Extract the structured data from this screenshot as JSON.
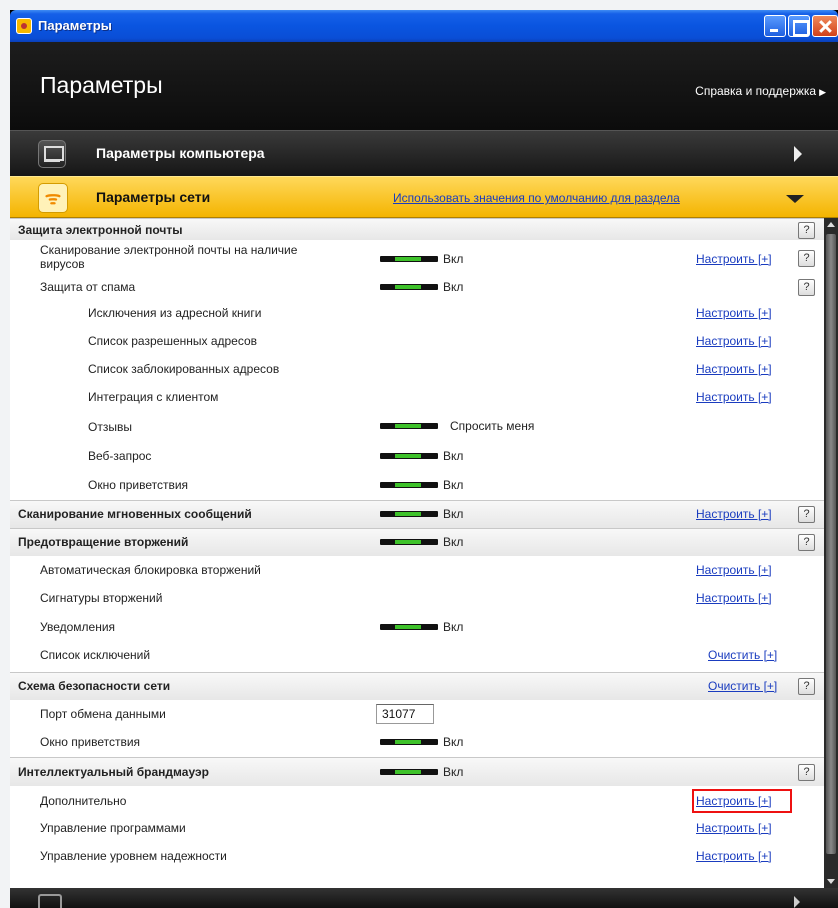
{
  "window": {
    "title": "Параметры"
  },
  "header": {
    "title": "Параметры",
    "help_link": "Справка и поддержка"
  },
  "bars": {
    "computer": {
      "label": "Параметры компьютера"
    },
    "network": {
      "label": "Параметры сети",
      "defaults_link": "Использовать значения по умолчанию для раздела"
    }
  },
  "rows": [
    {
      "label": "Защита электронной почты",
      "help": "?"
    },
    {
      "label": "Сканирование электронной почты на наличие вирусов",
      "status": "Вкл",
      "action": "Настроить [+]",
      "help": "?"
    },
    {
      "label": "Защита от спама",
      "status": "Вкл",
      "help": "?"
    },
    {
      "label": "Исключения из адресной книги",
      "action": "Настроить [+]"
    },
    {
      "label": "Список разрешенных адресов",
      "action": "Настроить [+]"
    },
    {
      "label": "Список заблокированных адресов",
      "action": "Настроить [+]"
    },
    {
      "label": "Интеграция с клиентом",
      "action": "Настроить [+]"
    },
    {
      "label": "Отзывы",
      "status": "Спросить меня"
    },
    {
      "label": "Веб-запрос",
      "status": "Вкл"
    },
    {
      "label": "Окно приветствия",
      "status": "Вкл"
    },
    {
      "label": "Сканирование мгновенных сообщений",
      "status": "Вкл",
      "action": "Настроить [+]",
      "help": "?"
    },
    {
      "label": "Предотвращение вторжений",
      "status": "Вкл",
      "help": "?"
    },
    {
      "label": "Автоматическая блокировка вторжений",
      "action": "Настроить [+]"
    },
    {
      "label": "Сигнатуры вторжений",
      "action": "Настроить [+]"
    },
    {
      "label": "Уведомления",
      "status": "Вкл"
    },
    {
      "label": "Список исключений",
      "action": "Очистить [+]"
    },
    {
      "label": "Схема безопасности сети",
      "action": "Очистить [+]",
      "help": "?"
    },
    {
      "label": "Порт обмена данными",
      "value": "31077"
    },
    {
      "label": "Окно приветствия",
      "status": "Вкл"
    },
    {
      "label": "Интеллектуальный брандмауэр",
      "status": "Вкл",
      "help": "?"
    },
    {
      "label": "Дополнительно",
      "action": "Настроить [+]"
    },
    {
      "label": "Управление программами",
      "action": "Настроить [+]"
    },
    {
      "label": "Управление уровнем надежности",
      "action": "Настроить [+]"
    }
  ]
}
